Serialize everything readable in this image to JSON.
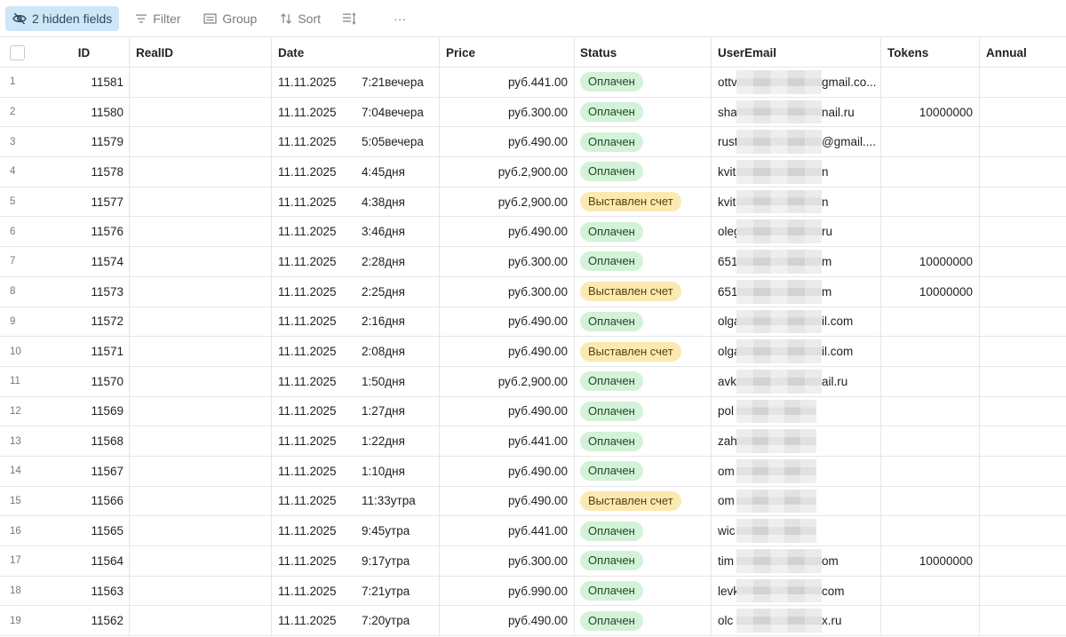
{
  "toolbar": {
    "hidden_fields": "2 hidden fields",
    "filter": "Filter",
    "group": "Group",
    "sort": "Sort",
    "more": "···"
  },
  "columns": {
    "id": "ID",
    "realid": "RealID",
    "date": "Date",
    "price": "Price",
    "status": "Status",
    "useremail": "UserEmail",
    "tokens": "Tokens",
    "annual": "Annual"
  },
  "rows": [
    {
      "idx": "1",
      "id": "11581",
      "date": "11.11.2025",
      "time": "7:21вечера",
      "price": "руб.441.00",
      "status": "Оплачен",
      "status_kind": "paid",
      "email_pre": "ottv",
      "email_post": "gmail.co...",
      "tokens": ""
    },
    {
      "idx": "2",
      "id": "11580",
      "date": "11.11.2025",
      "time": "7:04вечера",
      "price": "руб.300.00",
      "status": "Оплачен",
      "status_kind": "paid",
      "email_pre": "sha",
      "email_post": "nail.ru",
      "tokens": "10000000"
    },
    {
      "idx": "3",
      "id": "11579",
      "date": "11.11.2025",
      "time": "5:05вечера",
      "price": "руб.490.00",
      "status": "Оплачен",
      "status_kind": "paid",
      "email_pre": "rust",
      "email_post": "@gmail....",
      "tokens": ""
    },
    {
      "idx": "4",
      "id": "11578",
      "date": "11.11.2025",
      "time": "4:45дня",
      "price": "руб.2,900.00",
      "status": "Оплачен",
      "status_kind": "paid",
      "email_pre": "kvit",
      "email_post": "n",
      "tokens": ""
    },
    {
      "idx": "5",
      "id": "11577",
      "date": "11.11.2025",
      "time": "4:38дня",
      "price": "руб.2,900.00",
      "status": "Выставлен счет",
      "status_kind": "invoice",
      "email_pre": "kvit",
      "email_post": "n",
      "tokens": ""
    },
    {
      "idx": "6",
      "id": "11576",
      "date": "11.11.2025",
      "time": "3:46дня",
      "price": "руб.490.00",
      "status": "Оплачен",
      "status_kind": "paid",
      "email_pre": "oleg",
      "email_post": "ru",
      "tokens": ""
    },
    {
      "idx": "7",
      "id": "11574",
      "date": "11.11.2025",
      "time": "2:28дня",
      "price": "руб.300.00",
      "status": "Оплачен",
      "status_kind": "paid",
      "email_pre": "651",
      "email_post": "m",
      "tokens": "10000000"
    },
    {
      "idx": "8",
      "id": "11573",
      "date": "11.11.2025",
      "time": "2:25дня",
      "price": "руб.300.00",
      "status": "Выставлен счет",
      "status_kind": "invoice",
      "email_pre": "651",
      "email_post": "m",
      "tokens": "10000000"
    },
    {
      "idx": "9",
      "id": "11572",
      "date": "11.11.2025",
      "time": "2:16дня",
      "price": "руб.490.00",
      "status": "Оплачен",
      "status_kind": "paid",
      "email_pre": "olga",
      "email_post": "il.com",
      "tokens": ""
    },
    {
      "idx": "10",
      "id": "11571",
      "date": "11.11.2025",
      "time": "2:08дня",
      "price": "руб.490.00",
      "status": "Выставлен счет",
      "status_kind": "invoice",
      "email_pre": "olga",
      "email_post": "il.com",
      "tokens": ""
    },
    {
      "idx": "11",
      "id": "11570",
      "date": "11.11.2025",
      "time": "1:50дня",
      "price": "руб.2,900.00",
      "status": "Оплачен",
      "status_kind": "paid",
      "email_pre": "avk",
      "email_post": "ail.ru",
      "tokens": ""
    },
    {
      "idx": "12",
      "id": "11569",
      "date": "11.11.2025",
      "time": "1:27дня",
      "price": "руб.490.00",
      "status": "Оплачен",
      "status_kind": "paid",
      "email_pre": "pol",
      "email_post": "",
      "tokens": ""
    },
    {
      "idx": "13",
      "id": "11568",
      "date": "11.11.2025",
      "time": "1:22дня",
      "price": "руб.441.00",
      "status": "Оплачен",
      "status_kind": "paid",
      "email_pre": "zah",
      "email_post": "",
      "tokens": ""
    },
    {
      "idx": "14",
      "id": "11567",
      "date": "11.11.2025",
      "time": "1:10дня",
      "price": "руб.490.00",
      "status": "Оплачен",
      "status_kind": "paid",
      "email_pre": "om",
      "email_post": "",
      "tokens": ""
    },
    {
      "idx": "15",
      "id": "11566",
      "date": "11.11.2025",
      "time": "11:33утра",
      "price": "руб.490.00",
      "status": "Выставлен счет",
      "status_kind": "invoice",
      "email_pre": "om",
      "email_post": "",
      "tokens": ""
    },
    {
      "idx": "16",
      "id": "11565",
      "date": "11.11.2025",
      "time": "9:45утра",
      "price": "руб.441.00",
      "status": "Оплачен",
      "status_kind": "paid",
      "email_pre": "wic",
      "email_post": "",
      "tokens": ""
    },
    {
      "idx": "17",
      "id": "11564",
      "date": "11.11.2025",
      "time": "9:17утра",
      "price": "руб.300.00",
      "status": "Оплачен",
      "status_kind": "paid",
      "email_pre": "tim",
      "email_post": "om",
      "tokens": "10000000"
    },
    {
      "idx": "18",
      "id": "11563",
      "date": "11.11.2025",
      "time": "7:21утра",
      "price": "руб.990.00",
      "status": "Оплачен",
      "status_kind": "paid",
      "email_pre": "levk",
      "email_post": "com",
      "tokens": ""
    },
    {
      "idx": "19",
      "id": "11562",
      "date": "11.11.2025",
      "time": "7:20утра",
      "price": "руб.490.00",
      "status": "Оплачен",
      "status_kind": "paid",
      "email_pre": "olc",
      "email_post": "x.ru",
      "tokens": ""
    }
  ]
}
